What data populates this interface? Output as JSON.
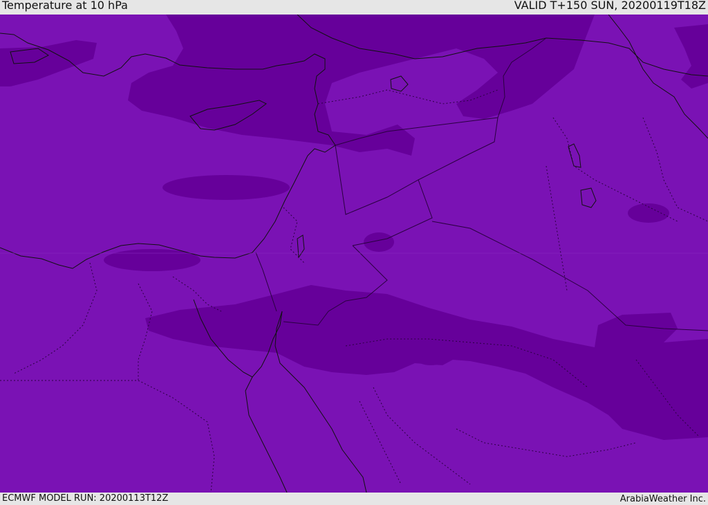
{
  "header": {
    "title": "Temperature at 10 hPa",
    "valid_time": "VALID T+150 SUN, 20200119T18Z"
  },
  "footer": {
    "model_run": "ECMWF MODEL RUN: 20200113T12Z",
    "credit": "ArabiaWeather Inc."
  },
  "map": {
    "background_color": "#7a12b4",
    "contour_color": "#66009a",
    "coastline_color": "#111111",
    "border_color": "#2a0040"
  }
}
